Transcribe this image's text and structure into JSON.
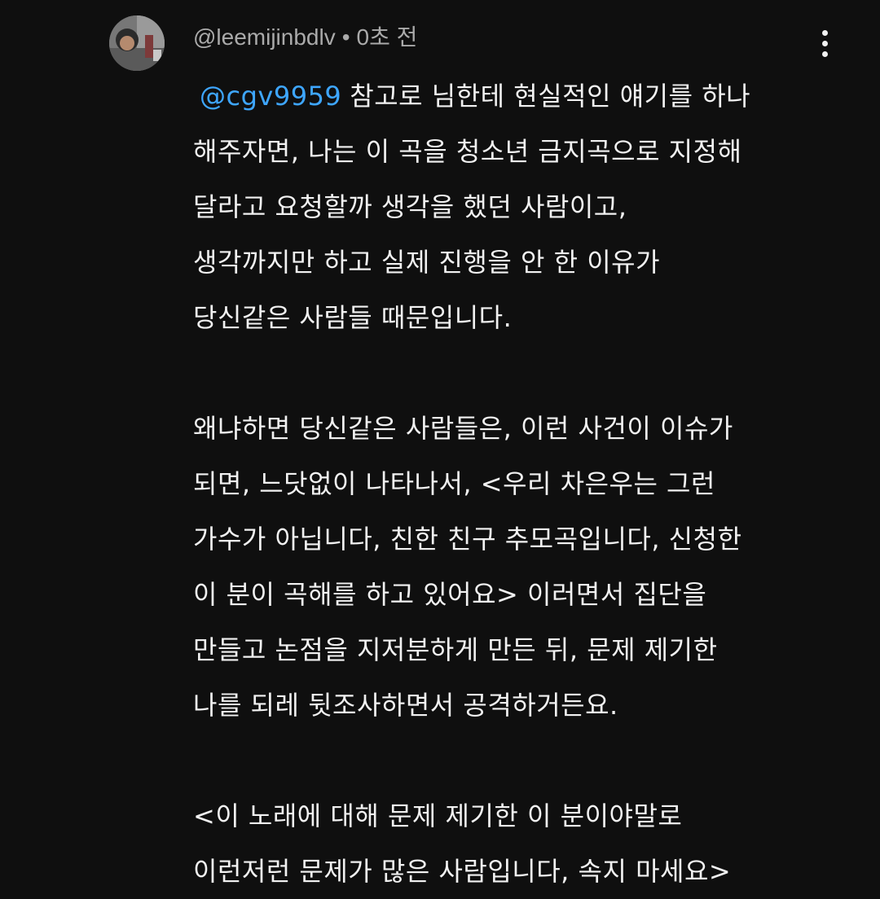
{
  "comment": {
    "username": "@leemijinbdlv",
    "separator": "•",
    "timestamp": "0초 전",
    "avatar_icon": "user-avatar",
    "menu_icon": "more-vert-icon",
    "mention": "@cgv9959",
    "lines": [
      "참고로 님한테 현실적인 얘기를 하나",
      "해주자면, 나는 이 곡을 청소년 금지곡으로 지정해",
      "달라고 요청할까 생각을 했던 사람이고,",
      "생각까지만 하고 실제 진행을 안 한 이유가",
      "당신같은 사람들 때문입니다.",
      "",
      "왜냐하면 당신같은 사람들은, 이런 사건이 이슈가",
      "되면, 느닷없이 나타나서, <우리 차은우는 그런",
      "가수가 아닙니다, 친한 친구 추모곡입니다, 신청한",
      "이 분이 곡해를 하고 있어요> 이러면서 집단을",
      "만들고 논점을 지저분하게 만든 뒤, 문제 제기한",
      "나를 되레 뒷조사하면서 공격하거든요.",
      "",
      "<이 노래에 대해 문제 제기한 이 분이야말로",
      "이런저런 문제가 많은 사람입니다, 속지 마세요>"
    ]
  },
  "colors": {
    "background": "#0f0f0f",
    "text": "#f1f1f1",
    "meta": "#aaaaaa",
    "mention": "#3ea6ff"
  }
}
